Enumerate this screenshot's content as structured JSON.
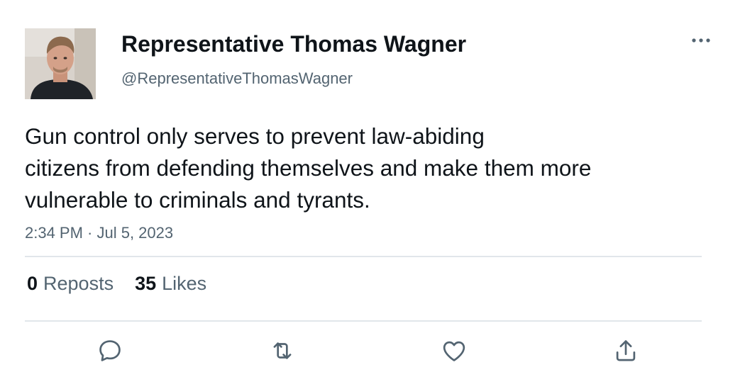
{
  "author": {
    "display_name": "Representative Thomas Wagner",
    "handle": "@RepresentativeThomasWagner",
    "avatar_icon": "profile-photo"
  },
  "tweet": {
    "text_lines": [
      "Gun control only serves to prevent law-abiding",
      "citizens from defending themselves and make them more",
      "vulnerable to criminals and tyrants."
    ],
    "timestamp": "2:34 PM · Jul 5, 2023"
  },
  "stats": {
    "reposts_count": "0",
    "reposts_label": "Reposts",
    "likes_count": "35",
    "likes_label": "Likes"
  },
  "actions": {
    "reply_icon": "speech-bubble-icon",
    "repost_icon": "repost-arrows-icon",
    "like_icon": "heart-icon",
    "share_icon": "share-upload-icon",
    "more_icon": "ellipsis-icon"
  },
  "colors": {
    "primary_text": "#0f1419",
    "secondary_text": "#536471",
    "divider": "#e1e6ea",
    "icon": "#536471"
  }
}
